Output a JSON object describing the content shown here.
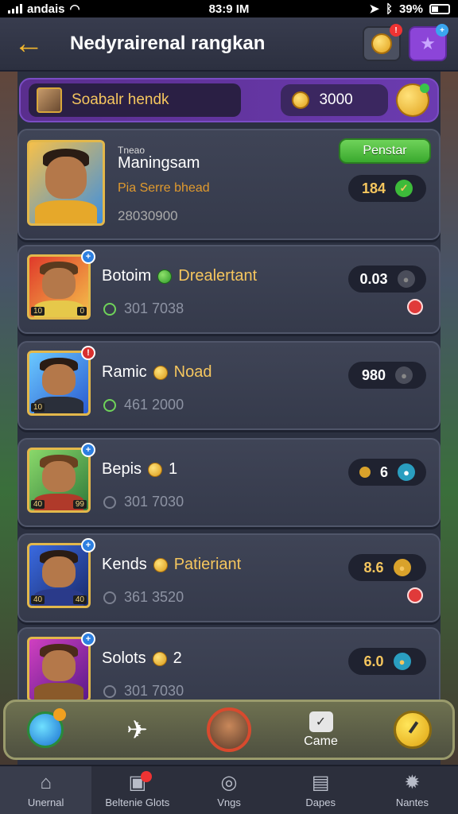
{
  "status_bar": {
    "carrier": "andais",
    "time": "83:9 IM",
    "battery": "39%"
  },
  "header": {
    "title": "Nedyrairenal rangkan"
  },
  "balance": {
    "name": "Soabalr hendk",
    "value": "3000"
  },
  "featured": {
    "subtitle": "Tneao",
    "name": "Maningsam",
    "role": "Pia Serre bhead",
    "id": "28030900",
    "status": "Penstar",
    "score": "184"
  },
  "rows": [
    {
      "name": "Botoim",
      "tag": "Drealertant",
      "id": "301 7038",
      "score": "0.03"
    },
    {
      "name": "Ramic",
      "tag": "Noad",
      "id": "461 2000",
      "score": "980"
    },
    {
      "name": "Bepis",
      "tag": "1",
      "id": "301 7030",
      "score": "6"
    },
    {
      "name": "Kends",
      "tag": "Patieriant",
      "id": "361 3520",
      "score": "8.6"
    },
    {
      "name": "Solots",
      "tag": "2",
      "id": "301 7030",
      "score": "6.0"
    }
  ],
  "portrait_tags": [
    {
      "l": "10",
      "r": "0"
    },
    {
      "l": "10",
      "r": ""
    },
    {
      "l": "40",
      "r": "99"
    },
    {
      "l": "40",
      "r": "40"
    },
    {
      "l": "",
      "r": ""
    }
  ],
  "action_bar": {
    "came_label": "Came"
  },
  "tabs": [
    {
      "label": "Unernal",
      "icon": "home-icon"
    },
    {
      "label": "Beltenie Glots",
      "icon": "cards-icon"
    },
    {
      "label": "Vngs",
      "icon": "target-icon"
    },
    {
      "label": "Dapes",
      "icon": "clipboard-icon"
    },
    {
      "label": "Nantes",
      "icon": "gear-icon"
    }
  ],
  "colors": {
    "accent_gold": "#f5c65e",
    "purple": "#6b3bb0",
    "green": "#3dbb3a"
  }
}
